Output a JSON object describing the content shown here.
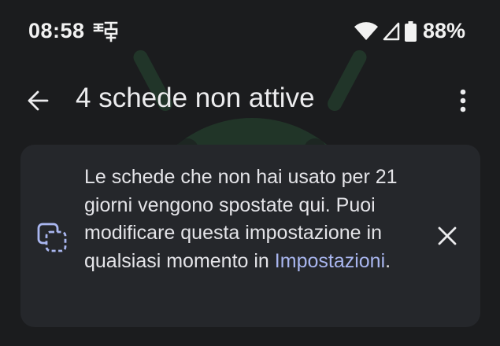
{
  "status_bar": {
    "time": "08:58",
    "battery": "88%",
    "icons": [
      "notification-icon",
      "wifi-icon",
      "cell-signal-icon",
      "battery-icon"
    ]
  },
  "app_bar": {
    "title": "4 schede non attive",
    "icons": [
      "back-arrow-icon",
      "more-vert-icon"
    ]
  },
  "info_card": {
    "text": "Le schede che non hai usato per 21 giorni vengono spostate qui. Puoi modificare questa impostazione in qualsiasi momento in ",
    "link": "Impostazioni",
    "trailing": ".",
    "icons": [
      "inactive-tabs-icon",
      "close-icon"
    ],
    "link_color": "#a9b6ef"
  },
  "colors": {
    "background": "#1b1c1e",
    "card": "#25272b",
    "watermark": "#2b5a3a"
  }
}
